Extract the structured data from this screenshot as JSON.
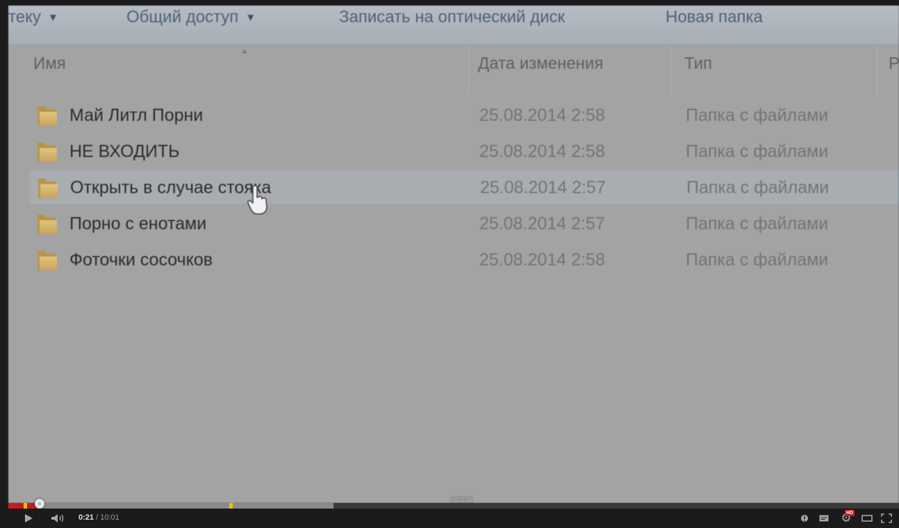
{
  "toolbar": {
    "items": [
      {
        "label": "теку",
        "dropdown": true
      },
      {
        "label": "Общий доступ",
        "dropdown": true
      },
      {
        "label": "Записать на оптический диск",
        "dropdown": false
      },
      {
        "label": "Новая папка",
        "dropdown": false
      }
    ]
  },
  "columns": {
    "name": "Имя",
    "date": "Дата изменения",
    "type": "Тип",
    "size_partial": "Р"
  },
  "files": [
    {
      "name": "Май Литл Порни",
      "date": "25.08.2014 2:58",
      "type": "Папка с файлами"
    },
    {
      "name": "НЕ ВХОДИТЬ",
      "date": "25.08.2014 2:58",
      "type": "Папка с файлами"
    },
    {
      "name": "Открыть в случае стояка",
      "date": "25.08.2014 2:57",
      "type": "Папка с файлами"
    },
    {
      "name": "Порно с енотами",
      "date": "25.08.2014 2:57",
      "type": "Папка с файлами"
    },
    {
      "name": "Фоточки сосочков",
      "date": "25.08.2014 2:58",
      "type": "Папка с файлами"
    }
  ],
  "hovered_row": 2,
  "player": {
    "current_time": "0:21",
    "separator": " / ",
    "duration": "10:01",
    "played_fraction": 0.035,
    "buffered_fraction": 0.365,
    "chapter_markers": [
      0.017,
      0.248
    ],
    "hd_label": "HD",
    "accent_color": "#cc181e",
    "marker_color": "#f0c000"
  },
  "icons": {
    "play": "play-icon",
    "volume": "volume-icon",
    "annotations": "annotations-icon",
    "captions": "captions-icon",
    "settings": "gear-icon",
    "theater": "theater-mode-icon",
    "fullscreen": "fullscreen-icon"
  }
}
